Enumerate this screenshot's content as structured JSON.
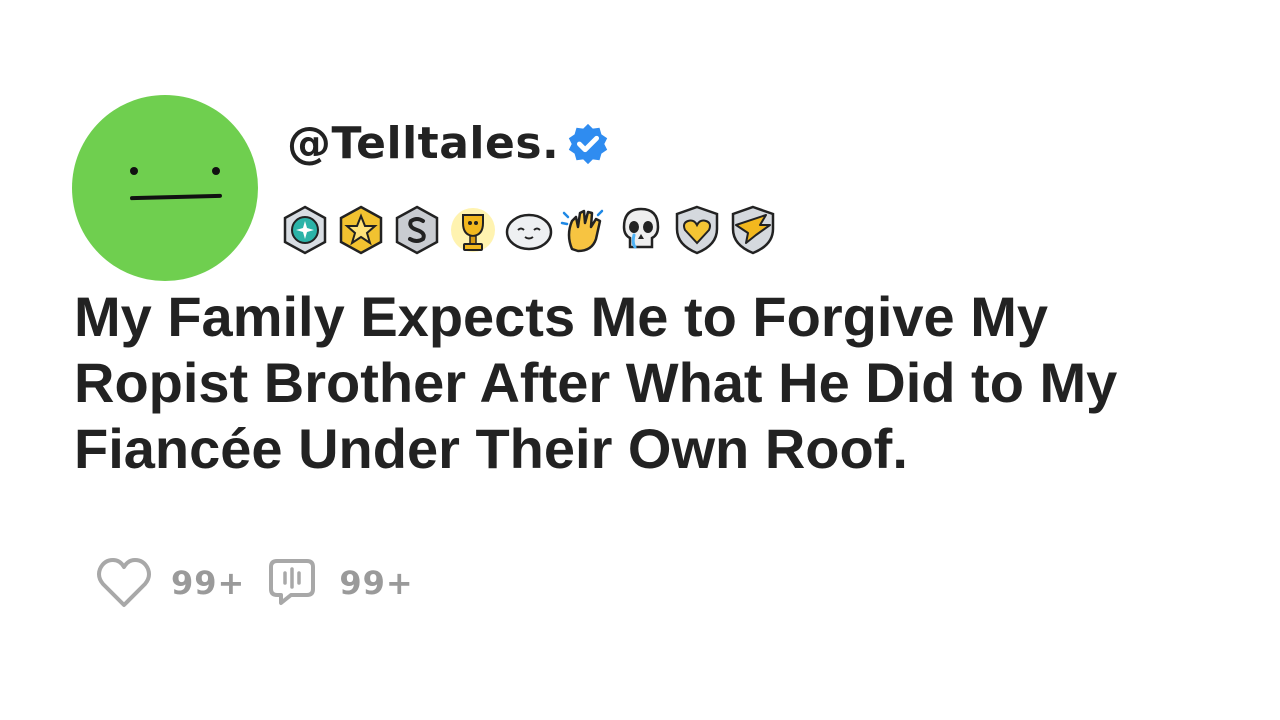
{
  "post": {
    "handle": "@Telltales.",
    "title": "My Family Expects Me to Forgive My Ropist Brother After What He Did to My Fiancée Under Their Own Roof.",
    "likes": "99+",
    "comments": "99+"
  },
  "badges": [
    "diamond-gem-award-icon",
    "gold-star-award-icon",
    "silver-s-award-icon",
    "gold-trophy-award-icon",
    "seal-award-icon",
    "clapping-hands-icon",
    "crying-skull-icon",
    "heart-shield-award-icon",
    "wing-shield-award-icon"
  ],
  "colors": {
    "avatar": "#6fcf4f",
    "verified": "#2f8cf0",
    "text": "#222222",
    "muted": "#9a9a9a"
  }
}
